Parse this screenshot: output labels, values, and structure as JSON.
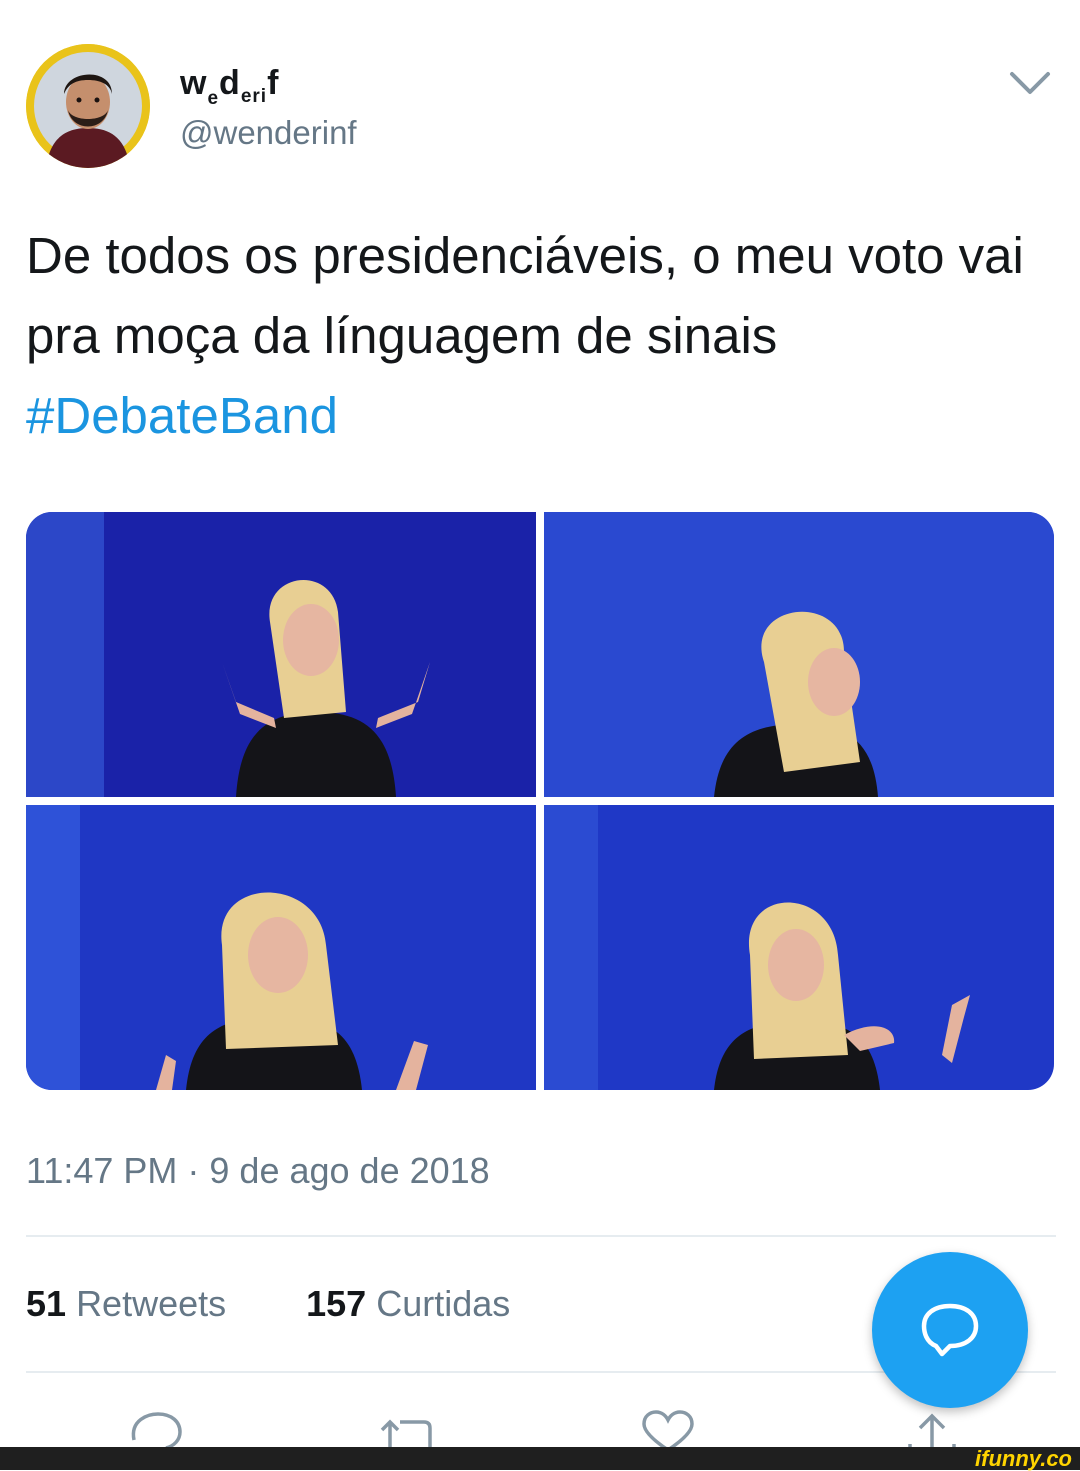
{
  "profile": {
    "display_name_parts": [
      "w",
      "e",
      "d",
      "eri",
      "f"
    ],
    "handle": "@wenderinf"
  },
  "tweet": {
    "text": "De todos os presidenciáveis, o meu voto vai pra moça da línguagem de sinais ",
    "hashtag": "#DebateBand"
  },
  "meta": {
    "timestamp": "11:47 PM · 9 de ago de 2018"
  },
  "stats": {
    "retweets_count": "51",
    "retweets_label": "Retweets",
    "likes_count": "157",
    "likes_label": "Curtidas"
  },
  "icons": {
    "menu": "chevron-down-icon",
    "reply": "reply-icon",
    "retweet": "retweet-icon",
    "like": "heart-icon",
    "share": "share-icon",
    "compose": "compose-reply-icon"
  },
  "watermark": "ifunny.co",
  "colors": {
    "link": "#1b95e0",
    "fab": "#1da1f2",
    "secondary_text": "#657786",
    "avatar_ring": "#e9c31a",
    "tv_background": "#1c2fd0"
  }
}
